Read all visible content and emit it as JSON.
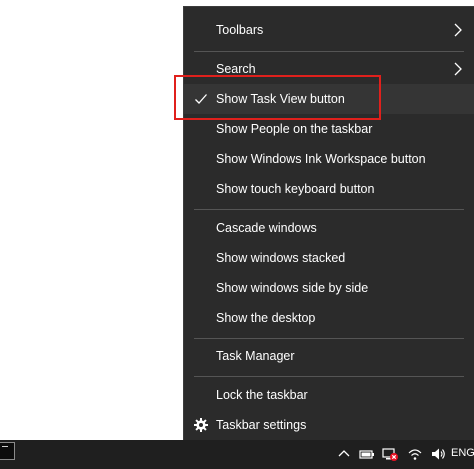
{
  "menu": {
    "items": [
      {
        "label": "Toolbars",
        "submenu": true
      },
      {
        "label": "Search",
        "submenu": true
      },
      {
        "label": "Show Task View button",
        "checked": true
      },
      {
        "label": "Show People on the taskbar"
      },
      {
        "label": "Show Windows Ink Workspace button"
      },
      {
        "label": "Show touch keyboard button"
      },
      {
        "label": "Cascade windows"
      },
      {
        "label": "Show windows stacked"
      },
      {
        "label": "Show windows side by side"
      },
      {
        "label": "Show the desktop"
      },
      {
        "label": "Task Manager"
      },
      {
        "label": "Lock the taskbar"
      },
      {
        "label": "Taskbar settings",
        "icon": "gear-icon"
      }
    ]
  },
  "taskbar": {
    "language": "ENG",
    "tray_icons": [
      "chevron-up-icon",
      "battery-icon",
      "network-disconnected-icon",
      "wifi-icon",
      "volume-icon"
    ]
  },
  "colors": {
    "menu_bg": "#2b2b2b",
    "highlight_box": "#e0201c",
    "taskbar_bg": "#1f1f1f"
  }
}
